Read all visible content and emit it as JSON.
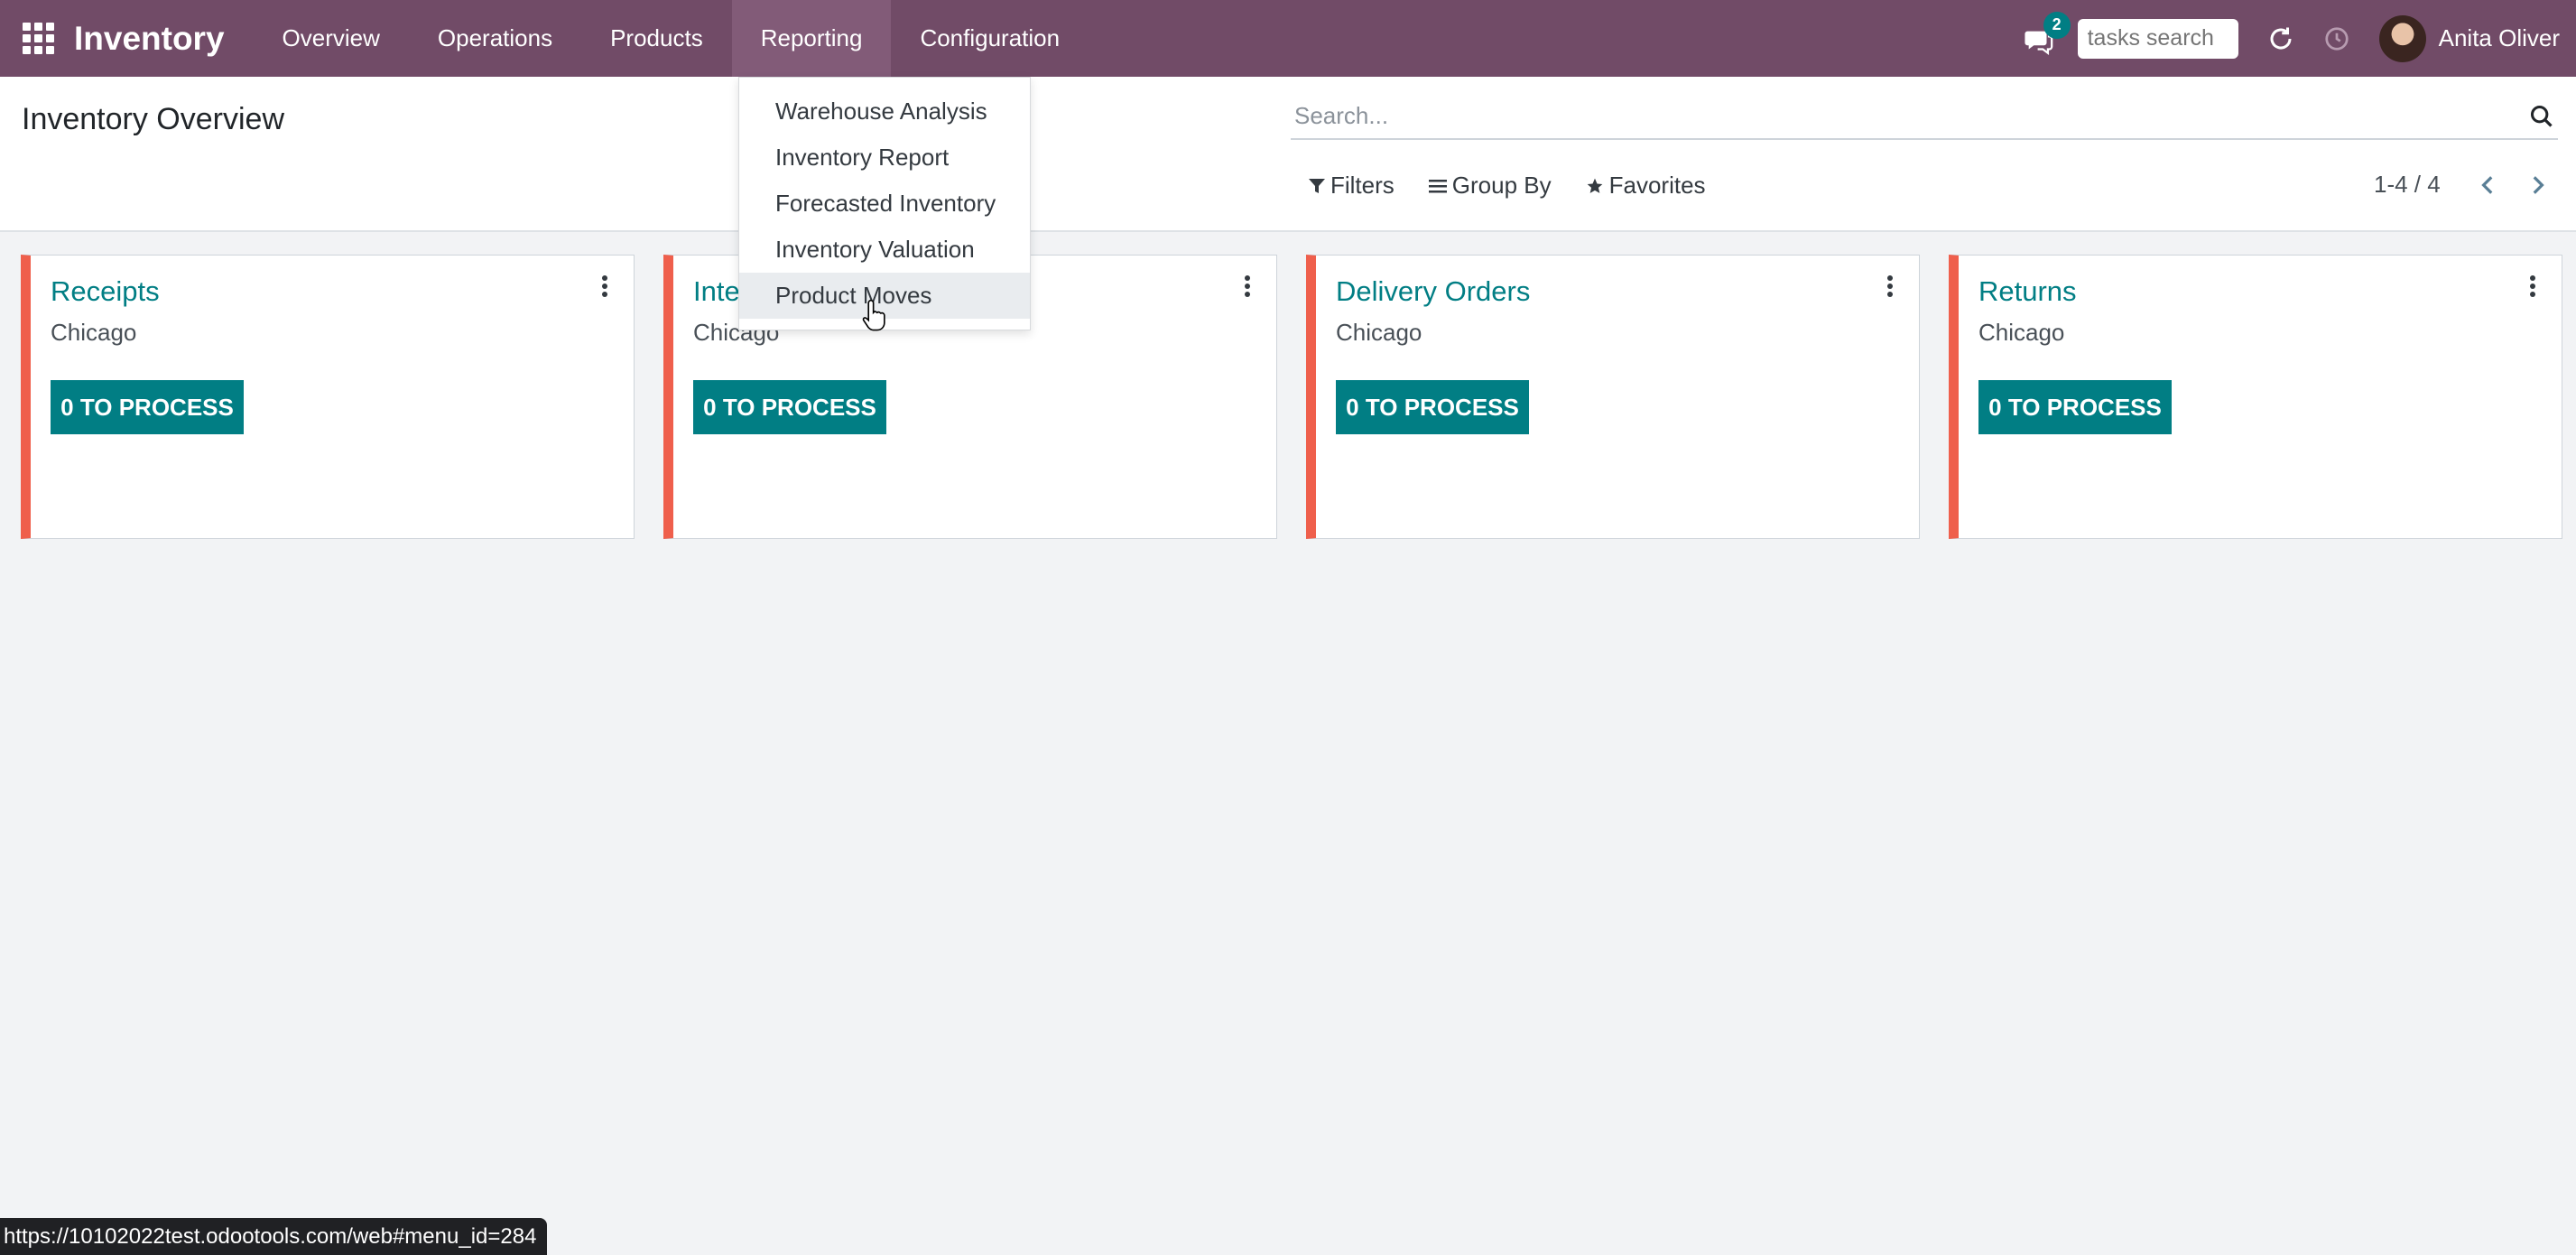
{
  "navbar": {
    "brand": "Inventory",
    "menus": [
      {
        "label": "Overview"
      },
      {
        "label": "Operations"
      },
      {
        "label": "Products"
      },
      {
        "label": "Reporting"
      },
      {
        "label": "Configuration"
      }
    ],
    "chat_badge": "2",
    "tasks_search_placeholder": "tasks search",
    "user_name": "Anita Oliver",
    "color": "#714b67"
  },
  "control_panel": {
    "title": "Inventory Overview",
    "search_placeholder": "Search...",
    "filters_label": "Filters",
    "group_by_label": "Group By",
    "favorites_label": "Favorites",
    "pager": "1-4 / 4"
  },
  "reporting_menu": {
    "items": [
      {
        "label": "Warehouse Analysis"
      },
      {
        "label": "Inventory Report"
      },
      {
        "label": "Forecasted Inventory"
      },
      {
        "label": "Inventory Valuation"
      },
      {
        "label": "Product Moves"
      }
    ],
    "hovered": "Product Moves"
  },
  "cards": [
    {
      "title": "Receipts",
      "warehouse": "Chicago",
      "button": "0 TO PROCESS"
    },
    {
      "title": "Internal Transfers",
      "warehouse": "Chicago",
      "button": "0 TO PROCESS"
    },
    {
      "title": "Delivery Orders",
      "warehouse": "Chicago",
      "button": "0 TO PROCESS"
    },
    {
      "title": "Returns",
      "warehouse": "Chicago",
      "button": "0 TO PROCESS"
    }
  ],
  "status_url": "https://10102022test.odootools.com/web#menu_id=284",
  "colors": {
    "accent": "#017e84",
    "card_border": "#ef5f4c"
  }
}
